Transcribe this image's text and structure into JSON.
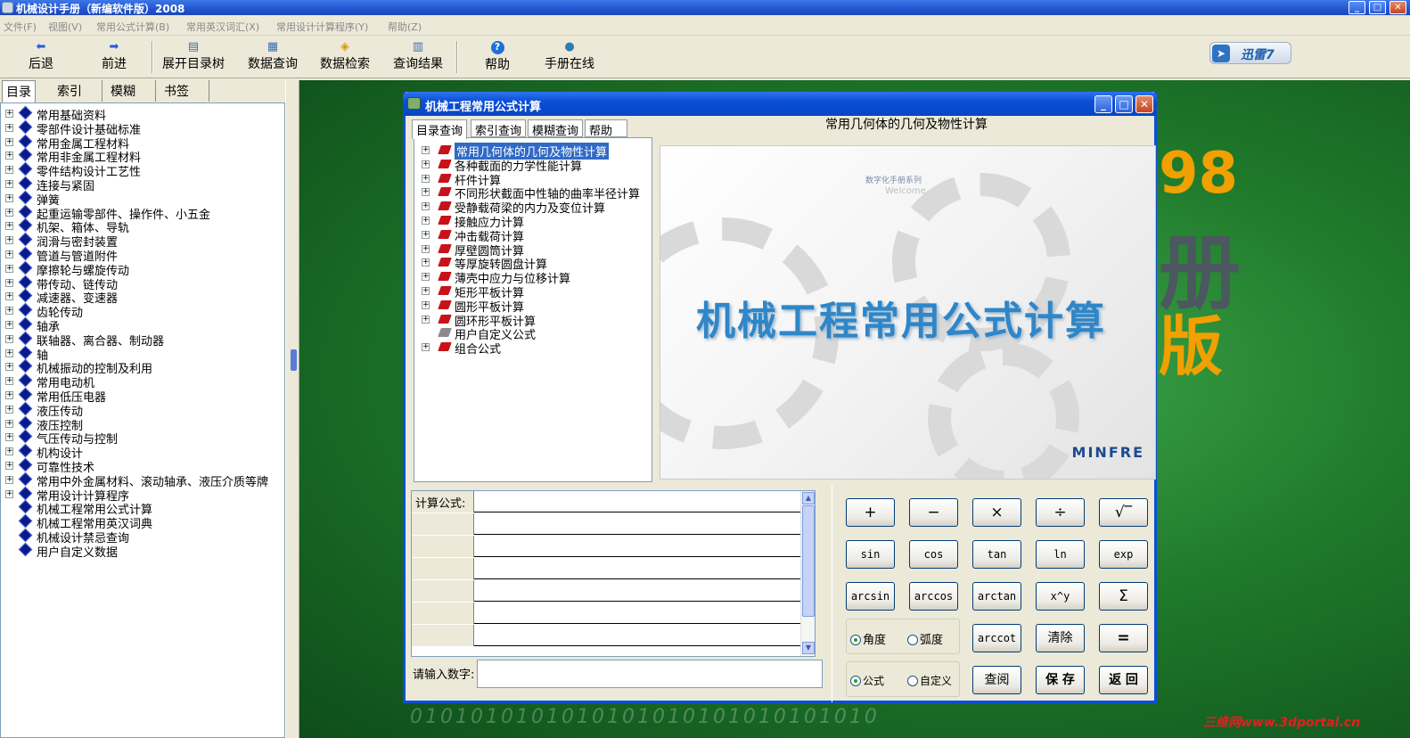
{
  "window": {
    "title": "机械设计手册（新编软件版）2008",
    "min": "_",
    "max": "□",
    "close": "✕"
  },
  "menu": [
    "文件(F)",
    "视图(V)",
    "常用公式计算(B)",
    "常用英汉词汇(X)",
    "常用设计计算程序(Y)",
    "帮助(Z)"
  ],
  "toolbar": [
    "后退",
    "前进",
    "展开目录树",
    "数据查询",
    "数据检索",
    "查询结果",
    "帮助",
    "手册在线"
  ],
  "xunlei": "迅雷7",
  "left_tabs": [
    "目录",
    "索引",
    "模糊",
    "书签"
  ],
  "tree": [
    "常用基础资料",
    "零部件设计基础标准",
    "常用金属工程材料",
    "常用非金属工程材料",
    "零件结构设计工艺性",
    "连接与紧固",
    "弹簧",
    "起重运输零部件、操作件、小五金",
    "机架、箱体、导轨",
    "润滑与密封装置",
    "管道与管道附件",
    "摩擦轮与螺旋传动",
    "带传动、链传动",
    "减速器、变速器",
    "齿轮传动",
    "轴承",
    "联轴器、离合器、制动器",
    "轴",
    "机械振动的控制及利用",
    "常用电动机",
    "常用低压电器",
    "液压传动",
    "液压控制",
    "气压传动与控制",
    "机构设计",
    "可靠性技术",
    "常用中外金属材料、滚动轴承、液压介质等牌",
    "常用设计计算程序",
    "机械工程常用公式计算",
    "机械工程常用英汉词典",
    "机械设计禁忌查询",
    "用户自定义数据"
  ],
  "background": {
    "num": "98",
    "big1": "册",
    "big2": "版",
    "binary": "0101010101010101010101010101010"
  },
  "watermark": "三维网www.3dportal.cn",
  "dialog": {
    "title": "机械工程常用公式计算",
    "tabs": [
      "目录查询",
      "索引查询",
      "模糊查询",
      "帮助"
    ],
    "tree": [
      "常用几何体的几何及物性计算",
      "各种截面的力学性能计算",
      "杆件计算",
      "不同形状截面中性轴的曲率半径计算",
      "受静载荷梁的内力及变位计算",
      "接触应力计算",
      "冲击载荷计算",
      "厚壁圆筒计算",
      "等厚旋转圆盘计算",
      "薄壳中应力与位移计算",
      "矩形平板计算",
      "圆形平板计算",
      "圆环形平板计算",
      "用户自定义公式",
      "组合公式"
    ],
    "right_title": "常用几何体的几何及物性计算",
    "splash": {
      "small": "数字化手册系列",
      "welcome": "Welcome",
      "big": "机械工程常用公式计算",
      "brand": "MINFRE"
    },
    "formula_label": "计算公式:",
    "number_label": "请输入数字:",
    "keys": [
      "+",
      "−",
      "×",
      "÷",
      "√‾",
      "sin",
      "cos",
      "tan",
      "ln",
      "exp",
      "arcsin",
      "arccos",
      "arctan",
      "x^y",
      "Σ",
      "arccot",
      "清除",
      "=",
      "查阅",
      "保 存",
      "返 回"
    ],
    "radios": {
      "deg": "角度",
      "rad": "弧度",
      "formula": "公式",
      "custom": "自定义"
    }
  }
}
